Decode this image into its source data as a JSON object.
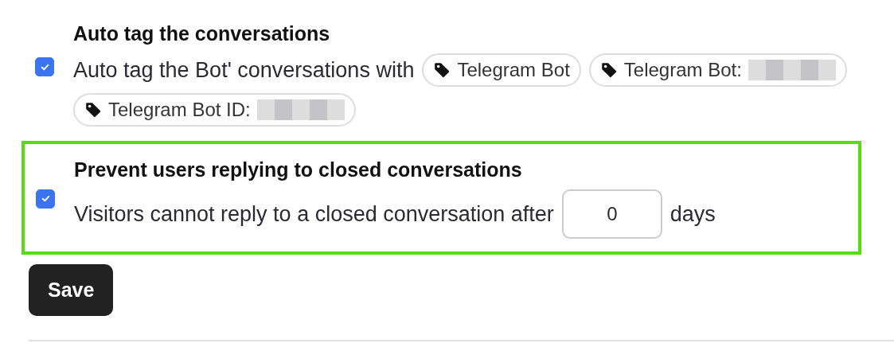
{
  "settings": [
    {
      "title": "Auto tag the conversations",
      "checked": true,
      "highlighted": false,
      "description": "Auto tag the Bot' conversations with",
      "tags": [
        {
          "label": "Telegram Bot",
          "redacted": false
        },
        {
          "label": "Telegram Bot:",
          "redacted": true
        },
        {
          "label": "Telegram Bot ID:",
          "redacted": true
        }
      ]
    },
    {
      "title": "Prevent users replying to closed conversations",
      "checked": true,
      "highlighted": true,
      "description": "Visitors cannot reply to a closed conversation after",
      "input": {
        "value": "0"
      },
      "suffix": "days"
    }
  ],
  "save_button": "Save"
}
